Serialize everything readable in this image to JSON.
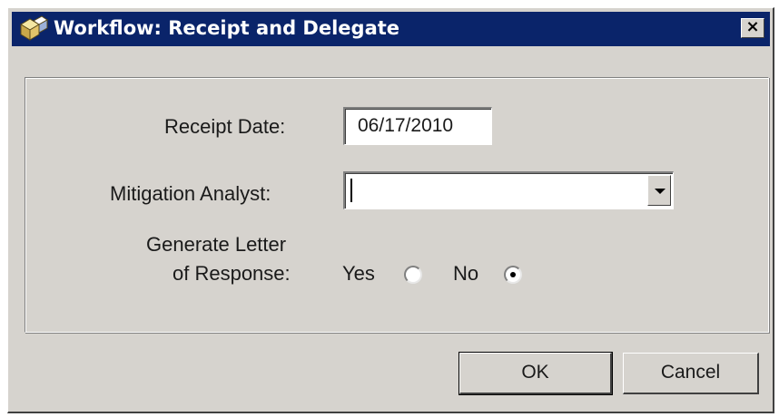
{
  "window": {
    "title": "Workflow: Receipt and Delegate",
    "close_label": "×",
    "titlebar_color": "#0a246a",
    "face_color": "#d6d3ce",
    "app_icon": "workflow-boxes-icon"
  },
  "form": {
    "receipt_date_label": "Receipt Date:",
    "receipt_date_value": "06/17/2010",
    "analyst_label": "Mitigation Analyst:",
    "analyst_value": "",
    "letter_label_line1": "Generate Letter",
    "letter_label_line2": "of Response:",
    "yes_label": "Yes",
    "no_label": "No",
    "letter_selected": "No"
  },
  "buttons": {
    "ok_label": "OK",
    "cancel_label": "Cancel"
  }
}
